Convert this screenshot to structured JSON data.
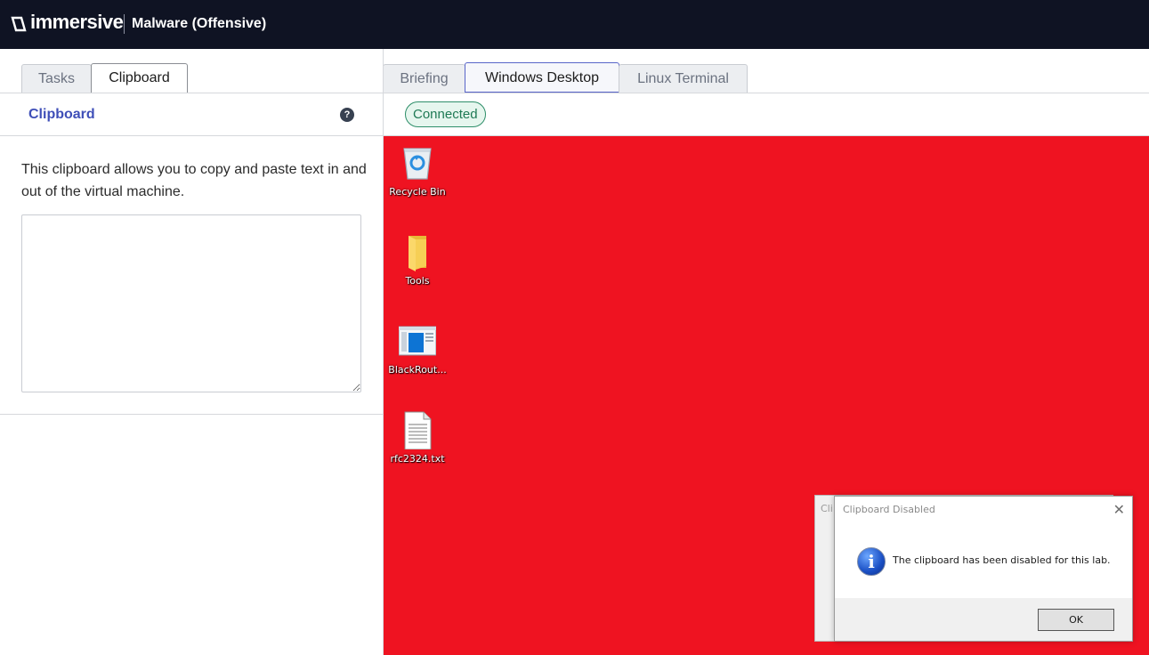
{
  "header": {
    "brand": "immersive",
    "lab_title": "Malware (Offensive)"
  },
  "left_tabs": [
    {
      "label": "Tasks"
    },
    {
      "label": "Clipboard",
      "active": true
    }
  ],
  "right_tabs": [
    {
      "label": "Briefing"
    },
    {
      "label": "Windows Desktop",
      "active": true
    },
    {
      "label": "Linux Terminal"
    }
  ],
  "clipboard": {
    "title": "Clipboard",
    "help": "?",
    "description": "This clipboard allows you to copy and paste text in and out of the virtual machine.",
    "value": ""
  },
  "connection": {
    "status": "Connected",
    "color": "#1f7a55"
  },
  "desktop": {
    "background": "#ef1321",
    "icons": [
      {
        "label": "Recycle Bin",
        "icon": "recycle-bin-icon"
      },
      {
        "label": "Tools",
        "icon": "folder-icon"
      },
      {
        "label": "BlackRout...",
        "icon": "application-icon"
      },
      {
        "label": "rfc2324.txt",
        "icon": "text-file-icon"
      }
    ]
  },
  "dialog_back": {
    "caption": "Cli"
  },
  "dialog": {
    "title": "Clipboard Disabled",
    "close": "✕",
    "info": "i",
    "message": "The clipboard has been disabled for this lab.",
    "ok_label": "OK"
  }
}
